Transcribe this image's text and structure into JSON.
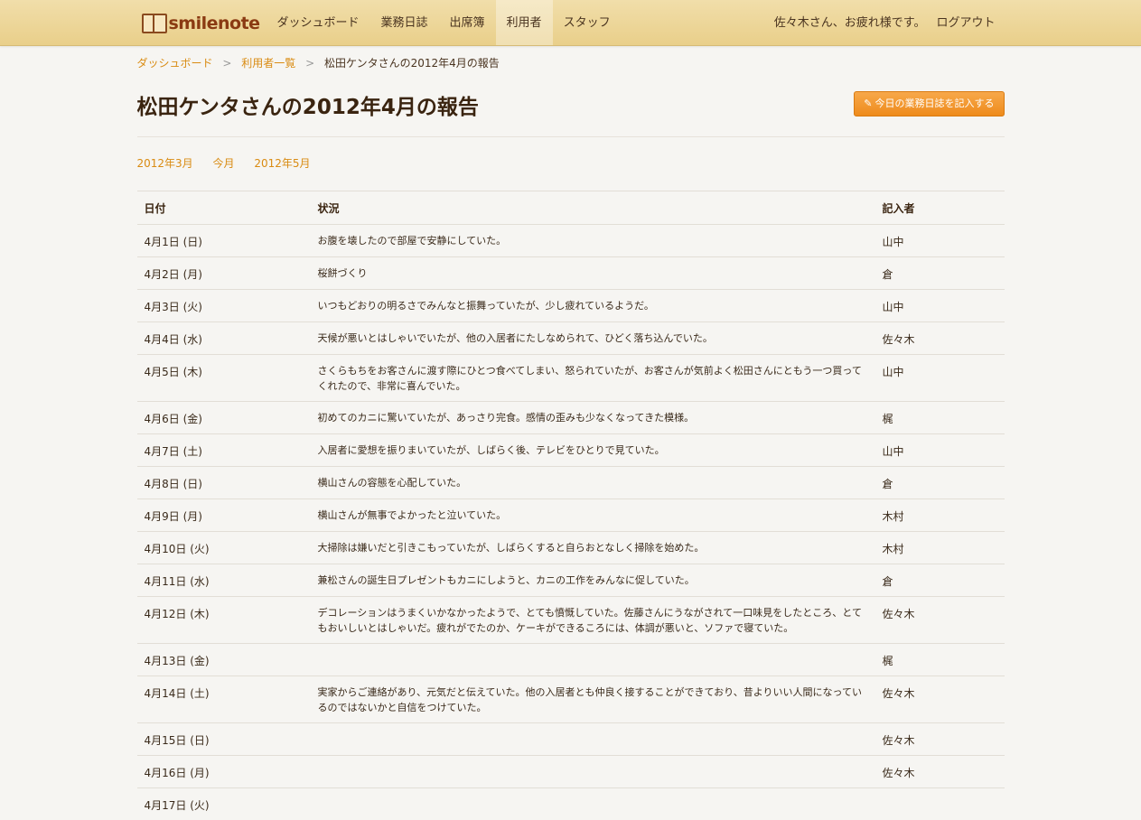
{
  "nav": {
    "logo_text": "smilenote",
    "links": [
      "ダッシュボード",
      "業務日誌",
      "出席簿",
      "利用者",
      "スタッフ"
    ],
    "active_index": 3,
    "greeting": "佐々木さん、お疲れ様です。",
    "logout": "ログアウト"
  },
  "breadcrumb": {
    "items": [
      "ダッシュボード",
      "利用者一覧"
    ],
    "current": "松田ケンタさんの2012年4月の報告",
    "separator": ">"
  },
  "page": {
    "title": "松田ケンタさんの2012年4月の報告",
    "write_button": "今日の業務日誌を記入する"
  },
  "month_nav": {
    "prev": "2012年3月",
    "current": "今月",
    "next": "2012年5月"
  },
  "table": {
    "headers": [
      "日付",
      "状況",
      "記入者"
    ],
    "rows": [
      {
        "date": "4月1日 (日)",
        "status": "お腹を壊したので部屋で安静にしていた。",
        "writer": "山中"
      },
      {
        "date": "4月2日 (月)",
        "status": "桜餅づくり",
        "writer": "倉"
      },
      {
        "date": "4月3日 (火)",
        "status": "いつもどおりの明るさでみんなと振舞っていたが、少し疲れているようだ。",
        "writer": "山中"
      },
      {
        "date": "4月4日 (水)",
        "status": "天候が悪いとはしゃいでいたが、他の入居者にたしなめられて、ひどく落ち込んでいた。",
        "writer": "佐々木"
      },
      {
        "date": "4月5日 (木)",
        "status": "さくらもちをお客さんに渡す際にひとつ食べてしまい、怒られていたが、お客さんが気前よく松田さんにともう一つ買ってくれたので、非常に喜んでいた。",
        "writer": "山中"
      },
      {
        "date": "4月6日 (金)",
        "status": "初めてのカニに驚いていたが、あっさり完食。感情の歪みも少なくなってきた模様。",
        "writer": "梶"
      },
      {
        "date": "4月7日 (土)",
        "status": "入居者に愛想を振りまいていたが、しばらく後、テレビをひとりで見ていた。",
        "writer": "山中"
      },
      {
        "date": "4月8日 (日)",
        "status": "横山さんの容態を心配していた。",
        "writer": "倉"
      },
      {
        "date": "4月9日 (月)",
        "status": "横山さんが無事でよかったと泣いていた。",
        "writer": "木村"
      },
      {
        "date": "4月10日 (火)",
        "status": "大掃除は嫌いだと引きこもっていたが、しばらくすると自らおとなしく掃除を始めた。",
        "writer": "木村"
      },
      {
        "date": "4月11日 (水)",
        "status": "兼松さんの誕生日プレゼントもカニにしようと、カニの工作をみんなに促していた。",
        "writer": "倉"
      },
      {
        "date": "4月12日 (木)",
        "status": "デコレーションはうまくいかなかったようで、とても憤慨していた。佐藤さんにうながされて一口味見をしたところ、とてもおいしいとはしゃいだ。疲れがでたのか、ケーキができるころには、体調が悪いと、ソファで寝ていた。",
        "writer": "佐々木"
      },
      {
        "date": "4月13日 (金)",
        "status": "",
        "writer": "梶"
      },
      {
        "date": "4月14日 (土)",
        "status": "実家からご連絡があり、元気だと伝えていた。他の入居者とも仲良く接することができており、昔よりいい人間になっているのではないかと自信をつけていた。",
        "writer": "佐々木"
      },
      {
        "date": "4月15日 (日)",
        "status": "",
        "writer": "佐々木"
      },
      {
        "date": "4月16日 (月)",
        "status": "",
        "writer": "佐々木"
      },
      {
        "date": "4月17日 (火)",
        "status": "",
        "writer": ""
      }
    ]
  }
}
